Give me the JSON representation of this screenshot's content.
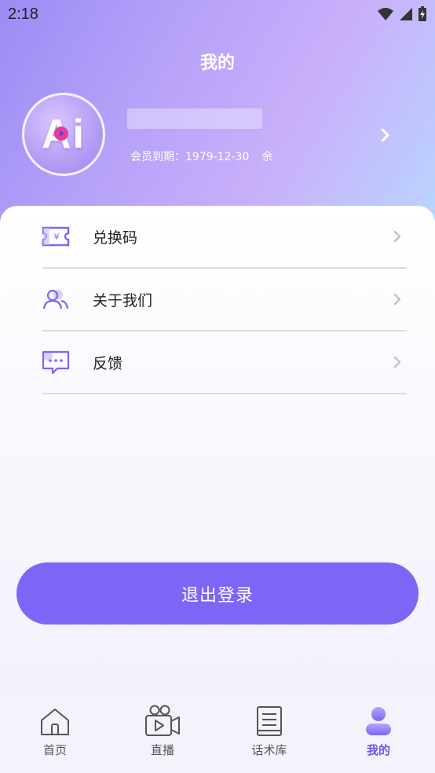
{
  "status": {
    "time": "2:18"
  },
  "header": {
    "title": "我的"
  },
  "profile": {
    "avatar_text": "Ai",
    "member_label": "会员到期：1979-12-30",
    "member_suffix": "余"
  },
  "menu": [
    {
      "label": "兑换码",
      "icon": "ticket-icon"
    },
    {
      "label": "关于我们",
      "icon": "users-icon"
    },
    {
      "label": "反馈",
      "icon": "chat-bubble-icon"
    }
  ],
  "logout": {
    "label": "退出登录"
  },
  "tabs": [
    {
      "label": "首页",
      "icon": "home-icon",
      "active": false
    },
    {
      "label": "直播",
      "icon": "video-camera-icon",
      "active": false
    },
    {
      "label": "话术库",
      "icon": "book-icon",
      "active": false
    },
    {
      "label": "我的",
      "icon": "person-icon",
      "active": true
    }
  ],
  "colors": {
    "accent": "#7b66f6",
    "active_tab": "#6a55e6"
  }
}
